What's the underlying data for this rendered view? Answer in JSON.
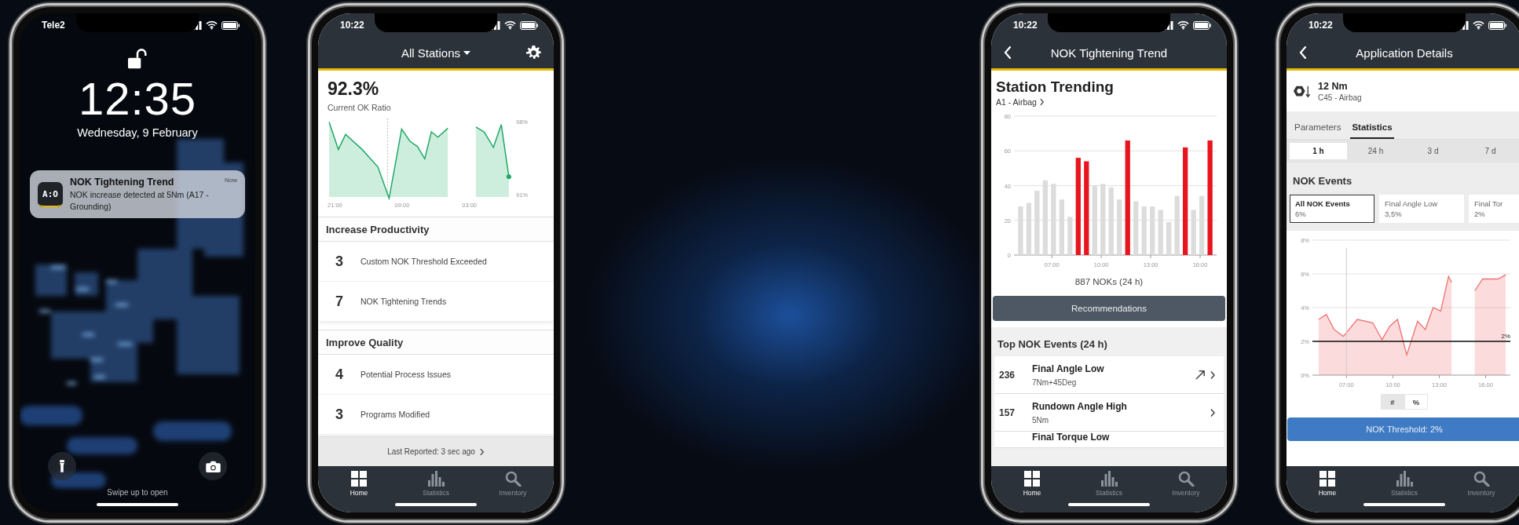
{
  "phones": [
    {
      "kind": "lock",
      "status": {
        "carrier": "Tele2"
      },
      "time": "12:35",
      "date": "Wednesday, 9 February",
      "notification": {
        "app_icon_text": "A:O",
        "title": "NOK Tightening Trend",
        "time": "Now",
        "body": "NOK increase detected at 5Nm (A17 - Grounding)"
      },
      "hint": "Swipe up to open"
    },
    {
      "kind": "home",
      "status": {
        "time": "10:22"
      },
      "header": {
        "title": "All Stations",
        "dropdown": true,
        "settings": true
      },
      "ratio": {
        "value": "92.3%",
        "label": "Current OK Ratio"
      },
      "sparkline": {
        "y_labels": [
          "98%",
          "91%"
        ],
        "x_labels": [
          "21:00",
          "09:00",
          "03:00"
        ]
      },
      "sections": [
        {
          "title": "Increase Productivity",
          "items": [
            {
              "count": "3",
              "label": "Custom NOK Threshold Exceeded"
            },
            {
              "count": "7",
              "label": "NOK Tightening Trends"
            }
          ]
        },
        {
          "title": "Improve Quality",
          "items": [
            {
              "count": "4",
              "label": "Potential Process Issues"
            },
            {
              "count": "3",
              "label": "Programs Modified"
            }
          ]
        }
      ],
      "footer": "Last Reported: 3 sec ago",
      "tabbar": [
        {
          "label": "Home",
          "selected": true
        },
        {
          "label": "Statistics",
          "selected": false
        },
        {
          "label": "Inventory",
          "selected": false
        }
      ]
    },
    {
      "kind": "trend",
      "status": {
        "time": "10:22"
      },
      "header": {
        "title": "NOK Tightening Trend",
        "back": true
      },
      "title": "Station Trending",
      "station": "A1 - Airbag",
      "chart_data": {
        "type": "bar",
        "x": [
          5.1,
          5.6,
          6.1,
          6.6,
          7.1,
          7.6,
          8.1,
          8.6,
          9.1,
          9.6,
          10.1,
          10.6,
          11.1,
          11.6,
          12.1,
          12.6,
          13.1,
          13.6,
          14.1,
          14.6,
          15.1,
          15.6,
          16.1,
          16.6
        ],
        "series": [
          {
            "color": "#dcdcdc",
            "values": [
              28,
              30,
              37,
              43,
              41,
              32,
              22,
              null,
              null,
              40,
              41,
              39,
              32,
              null,
              31,
              28,
              28,
              26,
              19,
              34,
              null,
              26,
              34,
              null
            ]
          },
          {
            "color": "#e8141e",
            "values": [
              null,
              null,
              null,
              null,
              null,
              null,
              null,
              56,
              54,
              null,
              null,
              null,
              null,
              66,
              null,
              null,
              null,
              null,
              null,
              null,
              62,
              null,
              null,
              66
            ]
          }
        ],
        "xlim": [
          4.7,
          17
        ],
        "ylim": [
          0,
          80
        ],
        "grid": true,
        "yticks": [
          0,
          20,
          40,
          60,
          80
        ],
        "xticks": [
          {
            "value": 7,
            "label": "07:00"
          },
          {
            "value": 10,
            "label": "10:00"
          },
          {
            "value": 13,
            "label": "13:00"
          },
          {
            "value": 16,
            "label": "16:00"
          }
        ]
      },
      "total": "887 NOKs (24 h)",
      "button": "Recommendations",
      "events_title": "Top NOK Events (24 h)",
      "events": [
        {
          "count": "236",
          "name": "Final Angle Low",
          "detail": "7Nm+45Deg",
          "trending": true
        },
        {
          "count": "157",
          "name": "Rundown Angle High",
          "detail": "5Nm",
          "trending": false
        },
        {
          "name": "Final Torque Low"
        }
      ],
      "tabbar": [
        {
          "label": "Home",
          "selected": true
        },
        {
          "label": "Statistics",
          "selected": false
        },
        {
          "label": "Inventory",
          "selected": false
        }
      ]
    },
    {
      "kind": "details",
      "status": {
        "time": "10:22"
      },
      "header": {
        "title": "Application Details",
        "back": true
      },
      "torque": "12 Nm",
      "application": "C45 - Airbag",
      "tabs": [
        {
          "label": "Parameters",
          "selected": false
        },
        {
          "label": "Statistics",
          "selected": true
        }
      ],
      "periods": [
        {
          "label": "1 h",
          "selected": true
        },
        {
          "label": "24 h",
          "selected": false
        },
        {
          "label": "3 d",
          "selected": false
        },
        {
          "label": "7 d",
          "selected": false
        }
      ],
      "events_title": "NOK Events",
      "cards": [
        {
          "title": "All NOK Events",
          "value": "6%",
          "selected": true
        },
        {
          "title": "Final Angle Low",
          "value": "3,5%",
          "selected": false
        },
        {
          "title": "Final Tor",
          "value": "2%",
          "selected": false
        }
      ],
      "chart_data": {
        "type": "area",
        "x": [
          5.2,
          5.7,
          6.2,
          6.8,
          7.7,
          8.7,
          9.3,
          9.8,
          10.3,
          10.9,
          11.6,
          12.1,
          12.6,
          13.1,
          13.6,
          13.8,
          15.3,
          15.8,
          16.8,
          17.3
        ],
        "series": [
          {
            "color": "#f07070",
            "values": [
              3.3,
              3.6,
              2.7,
              2.3,
              3.3,
              3.1,
              2.1,
              2.9,
              3.3,
              1.2,
              3.2,
              2.7,
              4.0,
              3.8,
              5.85,
              5.5,
              5.0,
              5.7,
              5.7,
              5.95
            ]
          }
        ],
        "xlim": [
          4.8,
          17.6
        ],
        "grid": true,
        "ylim": [
          0,
          8
        ],
        "yticks": [
          {
            "value": 0,
            "label": "0%"
          },
          {
            "value": 2,
            "label": "2%"
          },
          {
            "value": 4,
            "label": "4%"
          },
          {
            "value": 6,
            "label": "6%"
          },
          {
            "value": 8,
            "label": "8%"
          }
        ],
        "xticks": [
          {
            "value": 7,
            "label": "07:00"
          },
          {
            "value": 10,
            "label": "10:00"
          },
          {
            "value": 13,
            "label": "13:00"
          },
          {
            "value": 16,
            "label": "16:00"
          }
        ],
        "ref_lines": [
          {
            "axis": "x",
            "value": 7
          },
          {
            "axis": "y",
            "value": 2,
            "label": "2%"
          }
        ]
      },
      "units": [
        {
          "label": "#",
          "selected": false
        },
        {
          "label": "%",
          "selected": true
        }
      ],
      "button": "NOK Threshold: 2%",
      "tabbar": [
        {
          "label": "Home",
          "selected": true
        },
        {
          "label": "Statistics",
          "selected": false
        },
        {
          "label": "Inventory",
          "selected": false
        }
      ]
    }
  ]
}
